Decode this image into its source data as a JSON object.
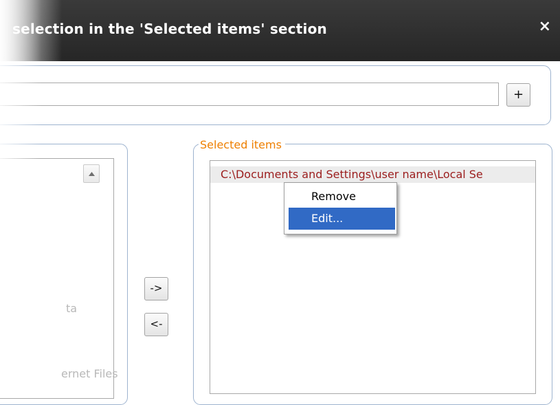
{
  "window": {
    "title": "selection in the 'Selected items' section",
    "close_glyph": "×"
  },
  "path_input": {
    "value": ""
  },
  "buttons": {
    "add": "+",
    "move_right": "->",
    "move_left": "<-"
  },
  "left_list": {
    "items": [
      "ta",
      "ernet Files"
    ]
  },
  "selected_items": {
    "legend": "Selected items",
    "entries": [
      "C:\\Documents and Settings\\user name\\Local Se"
    ]
  },
  "context_menu": {
    "items": [
      "Remove",
      "Edit..."
    ],
    "highlighted": "Edit..."
  },
  "colors": {
    "titlebar": "#2b2b2b",
    "legend": "#ee7f00",
    "entry_text": "#9b1d1d",
    "menu_highlight": "#316ac5",
    "panel_border": "#9db3cf"
  },
  "icons": [
    "close-icon",
    "scroll-up-arrow-icon"
  ]
}
